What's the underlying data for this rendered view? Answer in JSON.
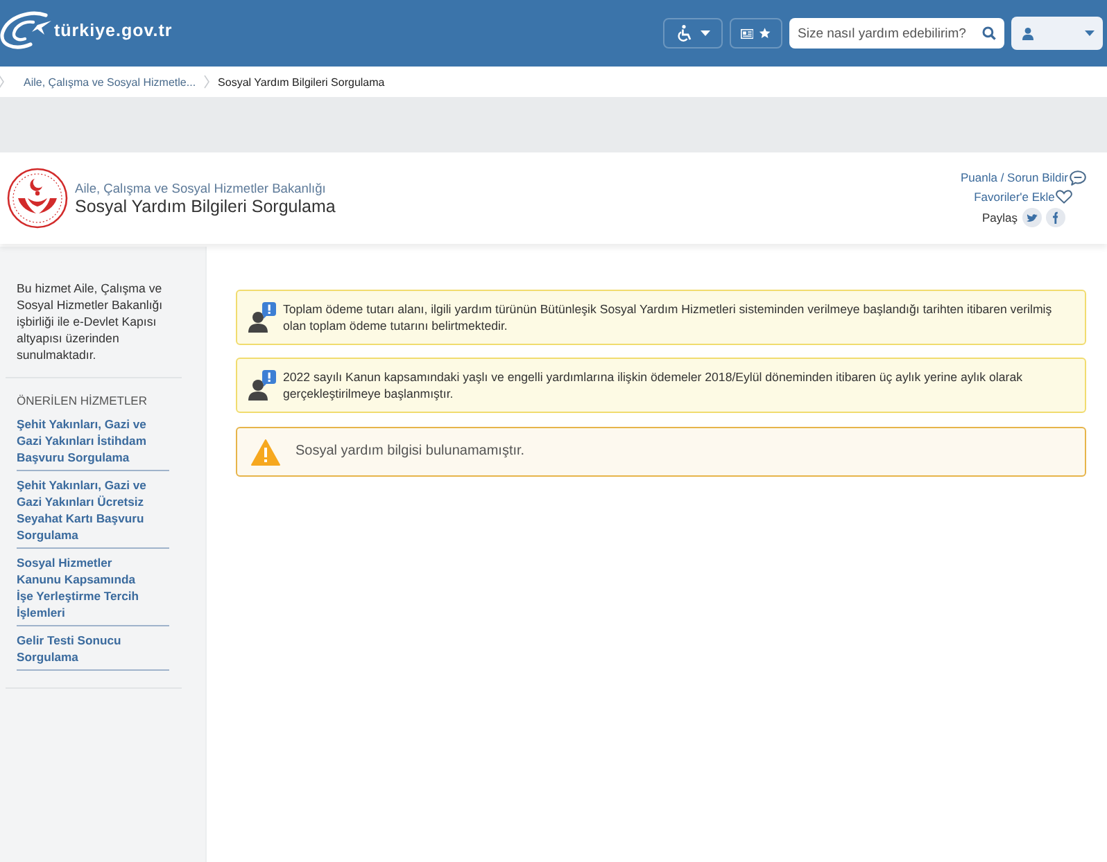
{
  "header": {
    "logo": "türkiye.gov.tr",
    "search": {
      "placeholder": "Size nasıl yardım edebilirim?"
    }
  },
  "breadcrumb": [
    {
      "label": "Aile, Çalışma ve Sosyal Hizmetle...",
      "current": false
    },
    {
      "label": "Sosyal Yardım Bilgileri Sorgulama",
      "current": true
    }
  ],
  "service_header": {
    "ministry": "Aile, Çalışma ve Sosyal Hizmetler Bakanlığı",
    "title": "Sosyal Yardım Bilgileri Sorgulama",
    "actions": [
      {
        "kind": "rate",
        "label": "Puanla / Sorun Bildir"
      },
      {
        "kind": "favorite",
        "label": "Favoriler'e Ekle"
      }
    ],
    "share_label": "Paylaş"
  },
  "sidebar": {
    "description": "Bu hizmet Aile, Çalışma ve Sosyal Hizmetler Bakanlığı işbirliği ile e-Devlet Kapısı altyapısı üzerinden sunulmaktadır.",
    "recommended_title": "ÖNERİLEN HİZMETLER",
    "recommended": [
      "Şehit Yakınları, Gazi ve Gazi Yakınları İstihdam Başvuru Sorgulama",
      "Şehit Yakınları, Gazi ve Gazi Yakınları Ücretsiz Seyahat Kartı Başvuru Sorgulama",
      "Sosyal Hizmetler Kanunu Kapsamında İşe Yerleştirme Tercih İşlemleri",
      "Gelir Testi Sonucu Sorgulama"
    ]
  },
  "alerts": [
    {
      "kind": "info",
      "text": "Toplam ödeme tutarı alanı, ilgili yardım türünün Bütünleşik Sosyal Yardım Hizmetleri sisteminden verilmeye başlandığı tarihten itibaren verilmiş olan toplam ödeme tutarını belirtmektedir."
    },
    {
      "kind": "info",
      "text": "2022 sayılı Kanun kapsamındaki yaşlı ve engelli yardımlarına ilişkin ödemeler 2018/Eylül döneminden itibaren üç aylık yerine aylık olarak gerçekleştirilmeye başlanmıştır."
    },
    {
      "kind": "warning",
      "text": "Sosyal yardım bilgisi bulunamamıştır."
    }
  ]
}
